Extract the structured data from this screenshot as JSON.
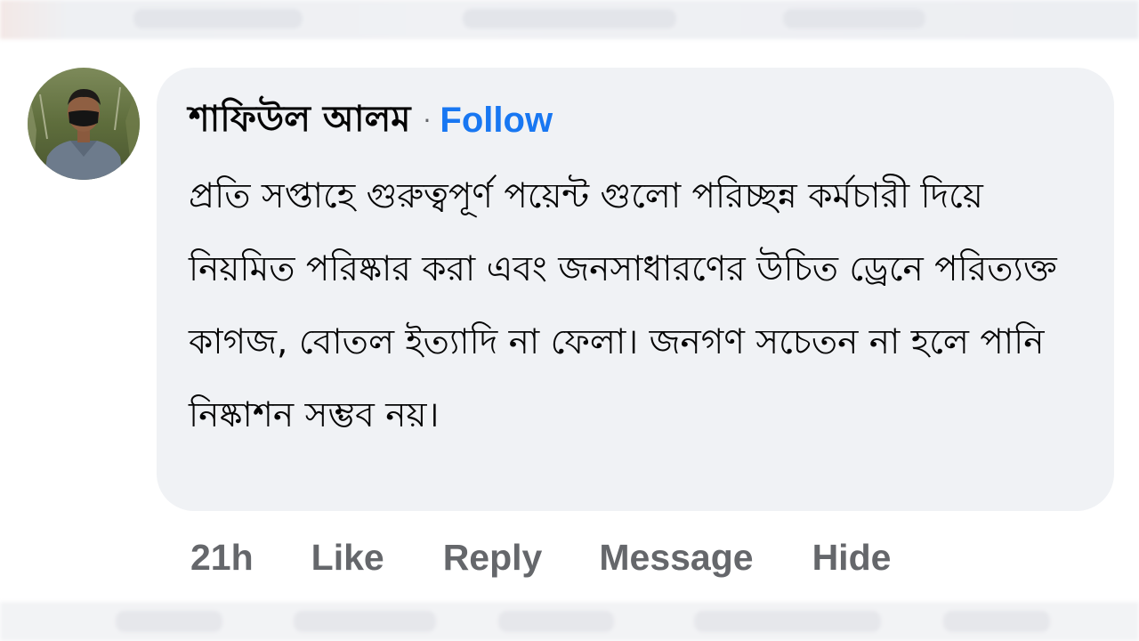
{
  "comment": {
    "author": "শাফিউল আলম",
    "separator": "·",
    "follow_label": "Follow",
    "text": "প্রতি সপ্তাহে গুরুত্বপূর্ণ পয়েন্ট গুলো পরিচ্ছন্ন কর্মচারী দিয়ে নিয়মিত পরিষ্কার করা এবং জনসাধারণের উচিত ড্রেনে পরিত্যক্ত কাগজ, বোতল ইত্যাদি না ফেলা। জনগণ সচেতন না হলে পানি নিষ্কাশন সম্ভব নয়।"
  },
  "actions": {
    "time": "21h",
    "like": "Like",
    "reply": "Reply",
    "message": "Message",
    "hide": "Hide"
  },
  "colors": {
    "bubble_bg": "#f0f2f5",
    "follow_blue": "#1877f2",
    "action_gray": "#65676b",
    "text": "#050505"
  }
}
